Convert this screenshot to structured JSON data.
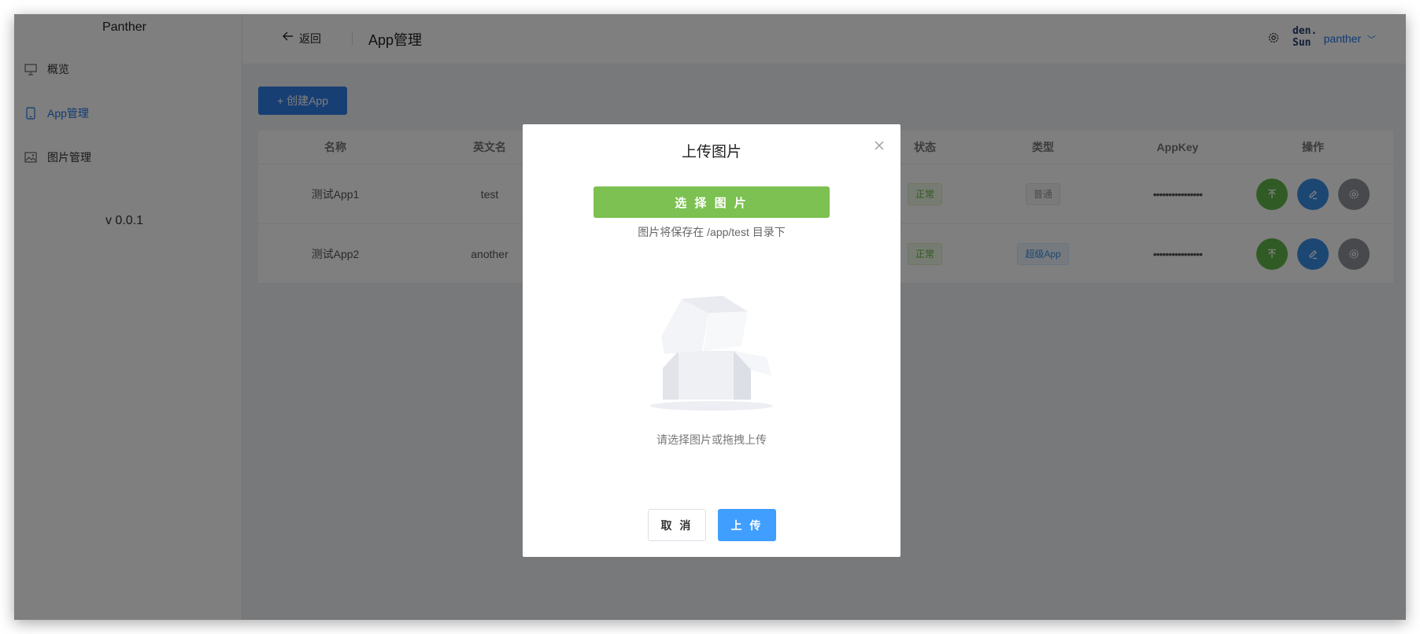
{
  "sidebar": {
    "brand": "Panther",
    "items": [
      {
        "label": "概览",
        "icon": "presentation-icon"
      },
      {
        "label": "App管理",
        "icon": "mobile-icon",
        "active": true
      },
      {
        "label": "图片管理",
        "icon": "image-icon"
      }
    ],
    "version": "v 0.0.1"
  },
  "header": {
    "back_label": "返回",
    "title": "App管理",
    "avatar_text": "den.Sun",
    "user": "panther"
  },
  "toolbar": {
    "create_label": "+ 创建App"
  },
  "table": {
    "columns": [
      "名称",
      "英文名",
      "",
      "",
      "",
      "状态",
      "类型",
      "AppKey",
      "操作"
    ],
    "rows": [
      {
        "name": "测试App1",
        "en_name": "test",
        "status": "正常",
        "type": "普通",
        "type_style": "gray",
        "app_key": "••••••••••••••••"
      },
      {
        "name": "测试App2",
        "en_name": "another",
        "status": "正常",
        "type": "超级App",
        "type_style": "blue",
        "app_key": "••••••••••••••••"
      }
    ]
  },
  "modal": {
    "title": "上传图片",
    "choose_label": "选 择 图 片",
    "hint": "图片将保存在 /app/test 目录下",
    "empty_text": "请选择图片或拖拽上传",
    "cancel_label": "取 消",
    "upload_label": "上 传"
  },
  "colors": {
    "primary": "#2f7fe8",
    "success": "#7cc151",
    "upload": "#409eff"
  }
}
